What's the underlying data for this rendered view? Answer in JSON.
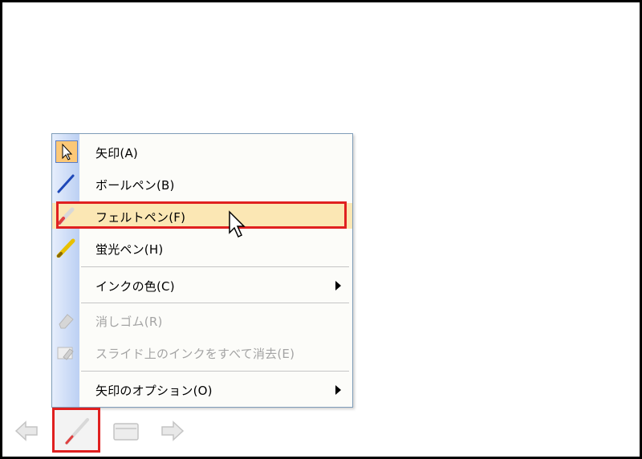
{
  "menu": {
    "items": [
      {
        "label": "矢印(A)",
        "icon": "arrow-pointer-icon",
        "enabled": true
      },
      {
        "label": "ボールペン(B)",
        "icon": "ballpoint-pen-icon",
        "enabled": true
      },
      {
        "label": "フェルトペン(F)",
        "icon": "felt-pen-icon",
        "enabled": true,
        "highlighted": true
      },
      {
        "label": "蛍光ペン(H)",
        "icon": "highlighter-icon",
        "enabled": true
      },
      {
        "label": "インクの色(C)",
        "icon": "",
        "enabled": true,
        "submenu": true
      },
      {
        "label": "消しゴム(R)",
        "icon": "eraser-icon",
        "enabled": false
      },
      {
        "label": "スライド上のインクをすべて消去(E)",
        "icon": "erase-all-ink-icon",
        "enabled": false
      },
      {
        "label": "矢印のオプション(O)",
        "icon": "",
        "enabled": true,
        "submenu": true
      }
    ]
  },
  "toolbar": {
    "buttons": [
      {
        "icon": "previous-arrow-icon"
      },
      {
        "icon": "pen-icon",
        "highlighted": true
      },
      {
        "icon": "slide-menu-icon"
      },
      {
        "icon": "next-arrow-icon"
      }
    ]
  },
  "colors": {
    "highlight_border": "#e02020",
    "menu_hover": "#fbe7b4",
    "menu_strip": "#bcd0f3",
    "disabled_text": "#a4a4a4"
  }
}
